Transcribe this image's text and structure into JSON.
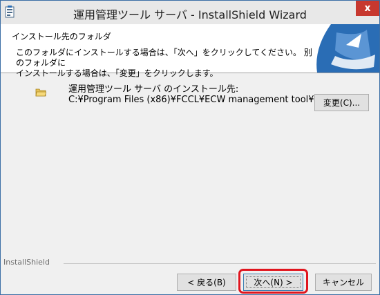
{
  "window": {
    "title": "運用管理ツール サーバ - InstallShield Wizard",
    "close_label": "x"
  },
  "banner": {
    "title": "インストール先のフォルダ",
    "description_line1": "このフォルダにインストールする場合は、「次へ」をクリックしてください。 別のフォルダに",
    "description_line2": "インストールする場合は、「変更」をクリックします。"
  },
  "destination": {
    "label": "運用管理ツール サーバ のインストール先:",
    "path": "C:¥Program Files (x86)¥FCCL¥ECW management tool¥",
    "change_label": "変更(C)..."
  },
  "footer": {
    "brand": "InstallShield",
    "back_label": "< 戻る(B)",
    "next_label": "次へ(N) >",
    "cancel_label": "キャンセル"
  },
  "colors": {
    "highlight": "#e0151e",
    "close_button": "#c7382f",
    "banner_logo": "#2a6db5"
  }
}
